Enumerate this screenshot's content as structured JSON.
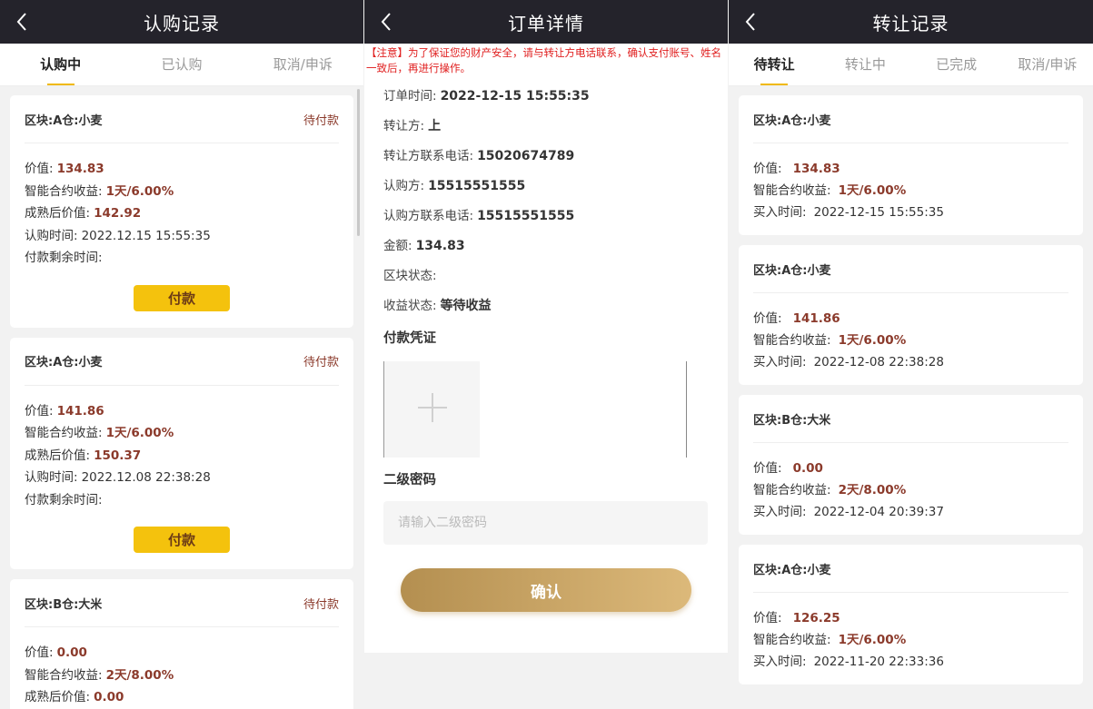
{
  "screen1": {
    "title": "认购记录",
    "tabs": [
      "认购中",
      "已认购",
      "取消/申诉"
    ],
    "labels": {
      "value": "价值:",
      "income": "智能合约收益:",
      "mature": "成熟后价值:",
      "time": "认购时间:",
      "remain": "付款剩余时间:"
    },
    "pay_label": "付款",
    "records": [
      {
        "name": "区块:A仓:小麦",
        "status": "待付款",
        "value": "134.83",
        "income": "1天/6.00%",
        "mature": "142.92",
        "time": "2022.12.15 15:55:35"
      },
      {
        "name": "区块:A仓:小麦",
        "status": "待付款",
        "value": "141.86",
        "income": "1天/6.00%",
        "mature": "150.37",
        "time": "2022.12.08 22:38:28"
      },
      {
        "name": "区块:B仓:大米",
        "status": "待付款",
        "value": "0.00",
        "income": "2天/8.00%",
        "mature": "0.00"
      }
    ]
  },
  "screen2": {
    "title": "订单详情",
    "notice": "【注意】为了保证您的财产安全，请与转让方电话联系，确认支付账号、姓名一致后，再进行操作。",
    "rows": [
      {
        "label": "订单时间:",
        "value": "2022-12-15 15:55:35"
      },
      {
        "label": "转让方:",
        "value": "上"
      },
      {
        "label": "转让方联系电话:",
        "value": "15020674789"
      },
      {
        "label": "认购方:",
        "value": "15515551555"
      },
      {
        "label": "认购方联系电话:",
        "value": "15515551555"
      },
      {
        "label": "金额:",
        "value": "134.83"
      },
      {
        "label": "区块状态:",
        "value": ""
      },
      {
        "label": "收益状态:",
        "value": "等待收益"
      }
    ],
    "voucher_title": "付款凭证",
    "pwd_title": "二级密码",
    "pwd_placeholder": "请输入二级密码",
    "confirm_label": "确认"
  },
  "screen3": {
    "title": "转让记录",
    "tabs": [
      "待转让",
      "转让中",
      "已完成",
      "取消/申诉"
    ],
    "labels": {
      "value": "价值:",
      "income": "智能合约收益:",
      "time": "买入时间:"
    },
    "records": [
      {
        "name": "区块:A仓:小麦",
        "value": "134.83",
        "income": "1天/6.00%",
        "time": "2022-12-15 15:55:35"
      },
      {
        "name": "区块:A仓:小麦",
        "value": "141.86",
        "income": "1天/6.00%",
        "time": "2022-12-08 22:38:28"
      },
      {
        "name": "区块:B仓:大米",
        "value": "0.00",
        "income": "2天/8.00%",
        "time": "2022-12-04 20:39:37"
      },
      {
        "name": "区块:A仓:小麦",
        "value": "126.25",
        "income": "1天/6.00%",
        "time": "2022-11-20 22:33:36"
      }
    ]
  },
  "colors": {
    "header_bg": "#24232b",
    "accent_yellow": "#f0b90b",
    "value_red": "#8b3a2b",
    "notice_red": "#e02020",
    "pay_button": "#f4c20d",
    "confirm_gradient": [
      "#b48f50",
      "#dcb97a"
    ]
  }
}
